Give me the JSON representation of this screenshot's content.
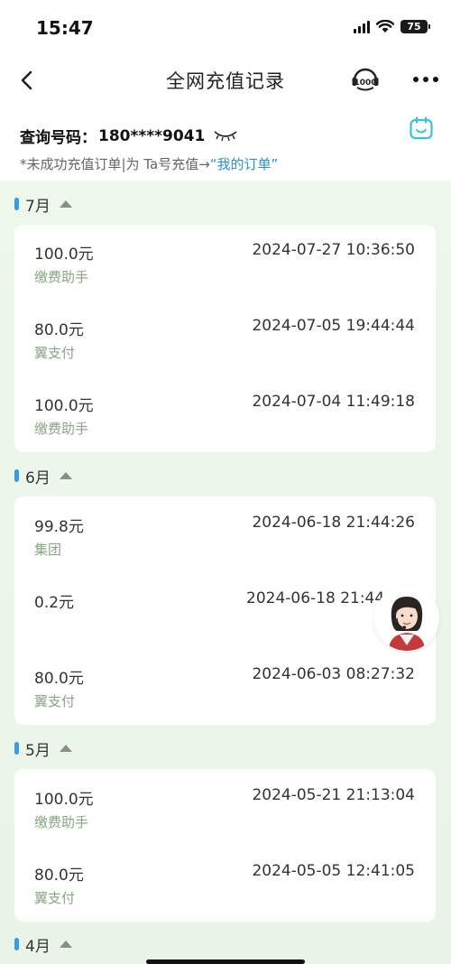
{
  "status_bar": {
    "time": "15:47",
    "battery": "75"
  },
  "nav": {
    "title": "全网充值记录"
  },
  "query": {
    "label": "查询号码：",
    "number": "180****9041",
    "tip_text": "*未成功充值订单|为 Ta号充值→",
    "tip_link": "“我的订单”"
  },
  "months": [
    {
      "label": "7月",
      "records": [
        {
          "amount": "100.0元",
          "datetime": "2024-07-27 10:36:50",
          "channel": "缴费助手"
        },
        {
          "amount": "80.0元",
          "datetime": "2024-07-05 19:44:44",
          "channel": "翼支付"
        },
        {
          "amount": "100.0元",
          "datetime": "2024-07-04 11:49:18",
          "channel": "缴费助手"
        }
      ]
    },
    {
      "label": "6月",
      "records": [
        {
          "amount": "99.8元",
          "datetime": "2024-06-18 21:44:26",
          "channel": "集团"
        },
        {
          "amount": "0.2元",
          "datetime": "2024-06-18 21:44",
          "channel": ""
        },
        {
          "amount": "80.0元",
          "datetime": "2024-06-03 08:27:32",
          "channel": "翼支付"
        }
      ]
    },
    {
      "label": "5月",
      "records": [
        {
          "amount": "100.0元",
          "datetime": "2024-05-21 21:13:04",
          "channel": "缴费助手"
        },
        {
          "amount": "80.0元",
          "datetime": "2024-05-05 12:41:05",
          "channel": "翼支付"
        }
      ]
    },
    {
      "label": "4月",
      "records": []
    }
  ],
  "colors": {
    "accent_blue": "#3a9ce0",
    "link_blue": "#2d8fd0",
    "channel_green": "#8aa584",
    "background_green": "#eef7ec",
    "calendar_cyan": "#3cc0e0"
  },
  "icons": {
    "back": "chevron-left-icon",
    "hotline": "headset-10000-icon",
    "more": "more-dots-icon",
    "eye": "eye-closed-icon",
    "calendar": "calendar-icon",
    "toggle": "caret-up-icon"
  }
}
